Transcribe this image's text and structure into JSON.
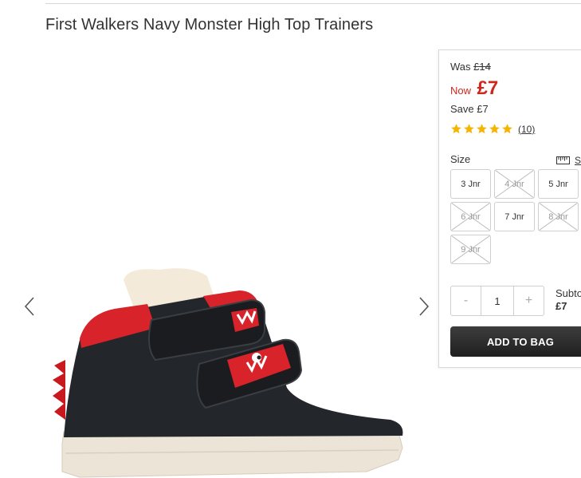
{
  "product": {
    "title": "First Walkers Navy Monster High Top Trainers"
  },
  "price": {
    "was_label": "Was",
    "was_value": "£14",
    "now_label": "Now",
    "now_value": "£7",
    "save_text": "Save £7",
    "accent_color": "#d0271d"
  },
  "rating": {
    "stars": 5,
    "review_count": "(10)",
    "star_color": "#f4b400"
  },
  "size": {
    "label": "Size",
    "guide_label": "S",
    "options": [
      {
        "label": "3 Jnr",
        "available": true
      },
      {
        "label": "4 Jnr",
        "available": false
      },
      {
        "label": "5 Jnr",
        "available": true
      },
      {
        "label": "6 Jnr",
        "available": false
      },
      {
        "label": "7 Jnr",
        "available": true
      },
      {
        "label": "8 Jnr",
        "available": false
      },
      {
        "label": "9 Jnr",
        "available": false
      }
    ]
  },
  "quantity": {
    "minus": "-",
    "value": "1",
    "plus": "+"
  },
  "subtotal": {
    "label": "Subto",
    "value": "£7"
  },
  "cta": {
    "add_to_bag": "ADD TO BAG"
  },
  "gallery": {
    "prev_icon": "chevron-left-icon",
    "next_icon": "chevron-right-icon"
  }
}
